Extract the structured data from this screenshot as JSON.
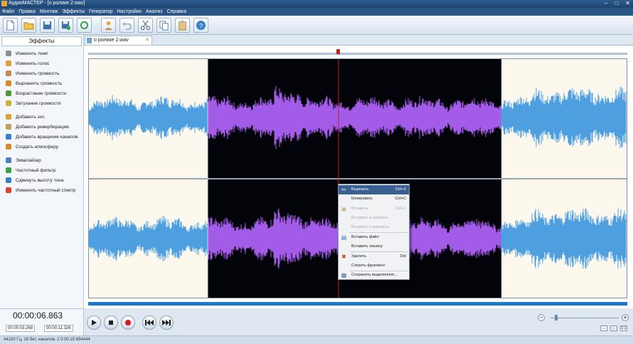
{
  "window": {
    "title": "АудиоМАСТЕР - [о ролике 2.wav]"
  },
  "menu": [
    "Файл",
    "Правка",
    "Монтаж",
    "Эффекты",
    "Генератор",
    "Настройки",
    "Анализ",
    "Справка"
  ],
  "toolbar": {
    "buttons": [
      "new-file-icon",
      "open-folder-icon",
      "save-icon",
      "save-as-icon",
      "refresh-icon",
      "record-person-icon",
      "undo-icon",
      "cut-icon",
      "copy-icon",
      "paste-icon",
      "help-icon"
    ]
  },
  "sidebar": {
    "header": "Эффекты",
    "items": [
      {
        "label": "Изменить темп",
        "icon": "tempo-icon",
        "color": "#8a8f98"
      },
      {
        "label": "Изменить голос",
        "icon": "voice-icon",
        "color": "#d9a23d"
      },
      {
        "label": "Изменить громкость",
        "icon": "volume-icon",
        "color": "#c88a52"
      },
      {
        "label": "Выровнять громкость",
        "icon": "normalize-icon",
        "color": "#d98a2a"
      },
      {
        "label": "Возрастание громкости",
        "icon": "fade-in-icon",
        "color": "#4a9a3b"
      },
      {
        "label": "Затухание громкости",
        "icon": "fade-out-icon",
        "color": "#c9b13a"
      },
      {
        "label": "Добавить эхо",
        "icon": "echo-icon",
        "color": "#d9a23d"
      },
      {
        "label": "Добавить реверберацию",
        "icon": "reverb-icon",
        "color": "#c0a060"
      },
      {
        "label": "Добавить вращение каналов",
        "icon": "rotate-icon",
        "color": "#3a7fc8"
      },
      {
        "label": "Создать атмосферу",
        "icon": "atmosphere-icon",
        "color": "#d98a2a"
      },
      {
        "label": "Эквалайзер",
        "icon": "equalizer-icon",
        "color": "#4f7fbf"
      },
      {
        "label": "Частотный фильтр",
        "icon": "filter-icon",
        "color": "#3aa14a"
      },
      {
        "label": "Сдвинуть высоту тона",
        "icon": "pitch-icon",
        "color": "#3a7fc8"
      },
      {
        "label": "Изменить частотный спектр",
        "icon": "spectrum-icon",
        "color": "#d9442a"
      }
    ]
  },
  "tab": {
    "label": "о ролике 2.wav"
  },
  "context_menu": {
    "items": [
      {
        "label": "Вырезать",
        "shortcut": "Ctrl+X",
        "state": "highlight",
        "icon": "cut-icon"
      },
      {
        "label": "Копировать",
        "shortcut": "Ctrl+C",
        "state": "enabled",
        "icon": ""
      },
      {
        "label": "Вставить",
        "shortcut": "Ctrl+V",
        "state": "disabled",
        "icon": "paste-icon"
      },
      {
        "label": "Вставить и смешать",
        "shortcut": "",
        "state": "disabled",
        "icon": ""
      },
      {
        "label": "Вставить и заменить",
        "shortcut": "",
        "state": "disabled",
        "icon": ""
      },
      {
        "label": "Вставить файл",
        "shortcut": "",
        "state": "enabled",
        "icon": "insert-file-icon"
      },
      {
        "label": "Вставить тишину",
        "shortcut": "",
        "state": "enabled",
        "icon": ""
      },
      {
        "label": "Удалить",
        "shortcut": "Del",
        "state": "enabled",
        "icon": "delete-icon"
      },
      {
        "label": "Стереть фрагмент",
        "shortcut": "",
        "state": "enabled",
        "icon": ""
      },
      {
        "label": "Сохранить выделенное...",
        "shortcut": "",
        "state": "enabled",
        "icon": "save-selection-icon"
      }
    ]
  },
  "time": {
    "current": "00:00:06.863",
    "selection_start": "00:00:03.268",
    "selection_end": "00:00:11.326"
  },
  "status": "44100 Гц, 16 бит, каналов: 2    0:00:15 654444",
  "colors": {
    "wave_unselected": "#4d9fe0",
    "wave_selected": "#a35ce8",
    "selection_bg": "#03030a",
    "unselected_bg": "#fdf8ee",
    "playhead": "#c91c1c",
    "menu_highlight": "#3a5f93"
  }
}
